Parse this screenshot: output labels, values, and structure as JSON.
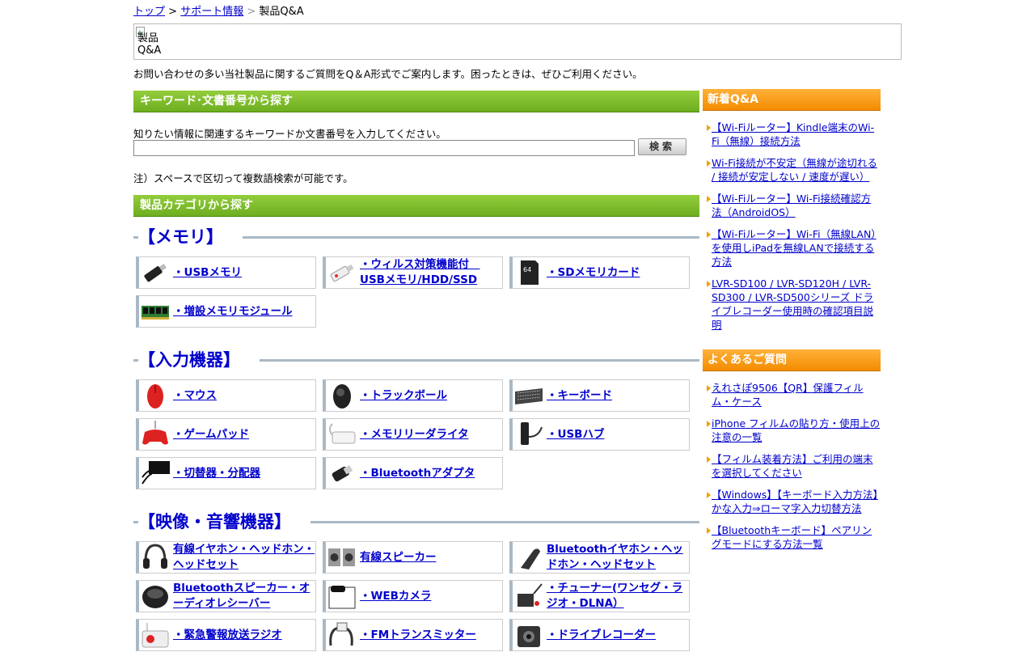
{
  "breadcrumb": {
    "top": "トップ",
    "sep1": ">",
    "support": "サポート情報",
    "sep2": ">",
    "current": "製品Q&A"
  },
  "banner_alt": "製品Q&A",
  "intro": "お問い合わせの多い当社製品に関するご質問をQ＆A形式でご案内します。困ったときは、ぜひご利用ください。",
  "keyword": {
    "heading": "キーワード･文書番号から探す",
    "prompt": "知りたい情報に関連するキーワードか文書番号を入力してください。",
    "input_value": "",
    "search_button": "検索",
    "note": "注）スペースで区切って複数語検索が可能です。"
  },
  "category_heading": "製品カテゴリから探す",
  "sections": [
    {
      "title": "【メモリ】",
      "items": [
        {
          "label": "・USBメモリ",
          "icon": "usb-memory-icon"
        },
        {
          "label": "・ウィルス対策機能付　USBメモリ/HDD/SSD",
          "icon": "antivirus-usb-icon"
        },
        {
          "label": "・SDメモリカード",
          "icon": "sd-card-icon"
        },
        {
          "label": "・増設メモリモジュール",
          "icon": "memory-module-icon"
        }
      ]
    },
    {
      "title": "【入力機器】",
      "items": [
        {
          "label": "・マウス",
          "icon": "mouse-icon"
        },
        {
          "label": "・トラックボール",
          "icon": "trackball-icon"
        },
        {
          "label": "・キーボード",
          "icon": "keyboard-icon"
        },
        {
          "label": "・ゲームパッド",
          "icon": "gamepad-icon"
        },
        {
          "label": "・メモリリーダライタ",
          "icon": "card-reader-icon"
        },
        {
          "label": "・USBハブ",
          "icon": "usb-hub-icon"
        },
        {
          "label": "・切替器・分配器",
          "icon": "switcher-icon"
        },
        {
          "label": "・Bluetoothアダプタ",
          "icon": "bluetooth-adapter-icon"
        }
      ]
    },
    {
      "title": "【映像・音響機器】",
      "items": [
        {
          "label": "有線イヤホン・ヘッドホン・ヘッドセット",
          "icon": "headphones-icon"
        },
        {
          "label": "有線スピーカー",
          "icon": "speaker-icon"
        },
        {
          "label": "Bluetoothイヤホン・ヘッドホン・ヘッドセット",
          "icon": "bluetooth-earphone-icon"
        },
        {
          "label": "Bluetoothスピーカー・オーディオレシーバー",
          "icon": "bluetooth-speaker-icon"
        },
        {
          "label": "・WEBカメラ",
          "icon": "webcam-icon"
        },
        {
          "label": "・チューナー(ワンセグ・ラジオ・DLNA）",
          "icon": "tuner-icon"
        },
        {
          "label": "・緊急警報放送ラジオ",
          "icon": "radio-icon"
        },
        {
          "label": "・FMトランスミッター",
          "icon": "fm-transmitter-icon"
        },
        {
          "label": "・ドライブレコーダー",
          "icon": "dashcam-icon"
        }
      ]
    }
  ],
  "sidebar": {
    "new_heading": "新着Q&A",
    "new_items": [
      "【Wi-Fiルーター】Kindle端末のWi-Fi（無線）接続方法",
      "Wi-Fi接続が不安定（無線が途切れる / 接続が安定しない / 速度が遅い）",
      "【Wi-Fiルーター】Wi-Fi接続確認方法（AndroidOS）",
      "【Wi-Fiルーター】Wi-Fi（無線LAN）を使用しiPadを無線LANで接続する方法",
      "LVR-SD100 / LVR-SD120H / LVR-SD300 / LVR-SD500シリーズ ドライブレコーダー使用時の確認項目説明"
    ],
    "faq_heading": "よくあるご質問",
    "faq_items": [
      "えれさぽ9506【QR】保護フィルム・ケース",
      "iPhone フィルムの貼り方・使用上の注意の一覧",
      "【フィルム装着方法】ご利用の端末を選択してください",
      "【Windows】【キーボード入力方法】かな入力⇒ローマ字入力切替方法",
      "【Bluetoothキーボード】ペアリングモードにする方法一覧"
    ]
  },
  "colors": {
    "link": "#0000cc",
    "green": "#7cbc2a",
    "orange": "#f5960c",
    "section_line": "#a9b8c4"
  }
}
